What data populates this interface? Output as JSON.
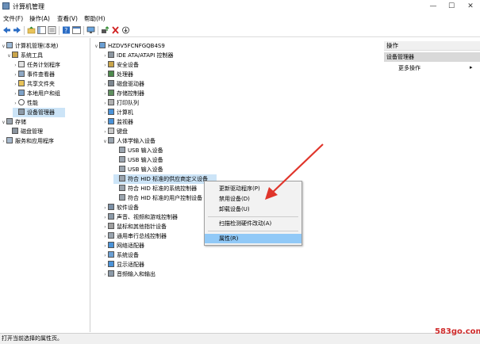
{
  "window": {
    "title": "计算机管理",
    "controls": [
      "—",
      "☐",
      "✕"
    ]
  },
  "menu": [
    "文件(F)",
    "操作(A)",
    "查看(V)",
    "帮助(H)"
  ],
  "toolbar": {
    "icons": [
      "back-icon",
      "forward-icon",
      "up-folder-icon",
      "show-tree-icon",
      "properties-icon",
      "help-icon",
      "view-icon",
      "monitor-icon",
      "update-driver-icon",
      "uninstall-icon",
      "disable-icon"
    ]
  },
  "left_tree": [
    {
      "label": "计算机管理(本地)",
      "arrow": "∨",
      "indent": 0
    },
    {
      "label": "系统工具",
      "arrow": "∨",
      "indent": 1
    },
    {
      "label": "任务计划程序",
      "arrow": "›",
      "indent": 2
    },
    {
      "label": "事件查看器",
      "arrow": "›",
      "indent": 2
    },
    {
      "label": "共享文件夹",
      "arrow": "›",
      "indent": 2
    },
    {
      "label": "本地用户和组",
      "arrow": "›",
      "indent": 2
    },
    {
      "label": "性能",
      "arrow": "›",
      "indent": 2
    },
    {
      "label": "设备管理器",
      "arrow": "",
      "indent": 2,
      "selected": true
    },
    {
      "label": "存储",
      "arrow": "∨",
      "indent": 1
    },
    {
      "label": "磁盘管理",
      "arrow": "",
      "indent": 2
    },
    {
      "label": "服务和应用程序",
      "arrow": "›",
      "indent": 1
    }
  ],
  "device_tree": [
    {
      "label": "HZDV5FCNFGQB4S9",
      "arrow": "∨",
      "indent": 0
    },
    {
      "label": "IDE ATA/ATAPI 控制器",
      "arrow": "›",
      "indent": 1
    },
    {
      "label": "安全设备",
      "arrow": "›",
      "indent": 1
    },
    {
      "label": "处理器",
      "arrow": "›",
      "indent": 1
    },
    {
      "label": "磁盘驱动器",
      "arrow": "›",
      "indent": 1
    },
    {
      "label": "存储控制器",
      "arrow": "›",
      "indent": 1
    },
    {
      "label": "打印队列",
      "arrow": "›",
      "indent": 1
    },
    {
      "label": "计算机",
      "arrow": "›",
      "indent": 1
    },
    {
      "label": "监视器",
      "arrow": "›",
      "indent": 1
    },
    {
      "label": "键盘",
      "arrow": "›",
      "indent": 1
    },
    {
      "label": "人体学输入设备",
      "arrow": "∨",
      "indent": 1
    },
    {
      "label": "USB 输入设备",
      "arrow": "",
      "indent": 2
    },
    {
      "label": "USB 输入设备",
      "arrow": "",
      "indent": 2
    },
    {
      "label": "USB 输入设备",
      "arrow": "",
      "indent": 2
    },
    {
      "label": "符合 HID 标准的供应商定义设备",
      "arrow": "",
      "indent": 2,
      "selected": true
    },
    {
      "label": "符合 HID 标准的系统控制器",
      "arrow": "",
      "indent": 2
    },
    {
      "label": "符合 HID 标准的用户控制设备",
      "arrow": "",
      "indent": 2
    },
    {
      "label": "软件设备",
      "arrow": "›",
      "indent": 1
    },
    {
      "label": "声音、视频和游戏控制器",
      "arrow": "›",
      "indent": 1
    },
    {
      "label": "鼠标和其他指针设备",
      "arrow": "›",
      "indent": 1
    },
    {
      "label": "通用串行总线控制器",
      "arrow": "›",
      "indent": 1
    },
    {
      "label": "网络适配器",
      "arrow": "›",
      "indent": 1
    },
    {
      "label": "系统设备",
      "arrow": "›",
      "indent": 1
    },
    {
      "label": "显示适配器",
      "arrow": "›",
      "indent": 1
    },
    {
      "label": "音频输入和输出",
      "arrow": "›",
      "indent": 1
    }
  ],
  "actions": {
    "header": "操作",
    "section": "设备管理器",
    "more": "更多操作",
    "more_arrow": "▸"
  },
  "context_menu": {
    "items": [
      "更新驱动程序(P)",
      "禁用设备(D)",
      "卸载设备(U)",
      "扫描检测硬件改动(A)",
      "属性(R)"
    ],
    "highlighted_index": 4
  },
  "status": {
    "text": "打开当前选择的属性页。"
  },
  "watermark": "583go.com",
  "colors": {
    "selection": "#cce4f7",
    "menu_highlight": "#91c9f7",
    "arrow": "#e0352b",
    "watermark": "#cf2b2b"
  }
}
